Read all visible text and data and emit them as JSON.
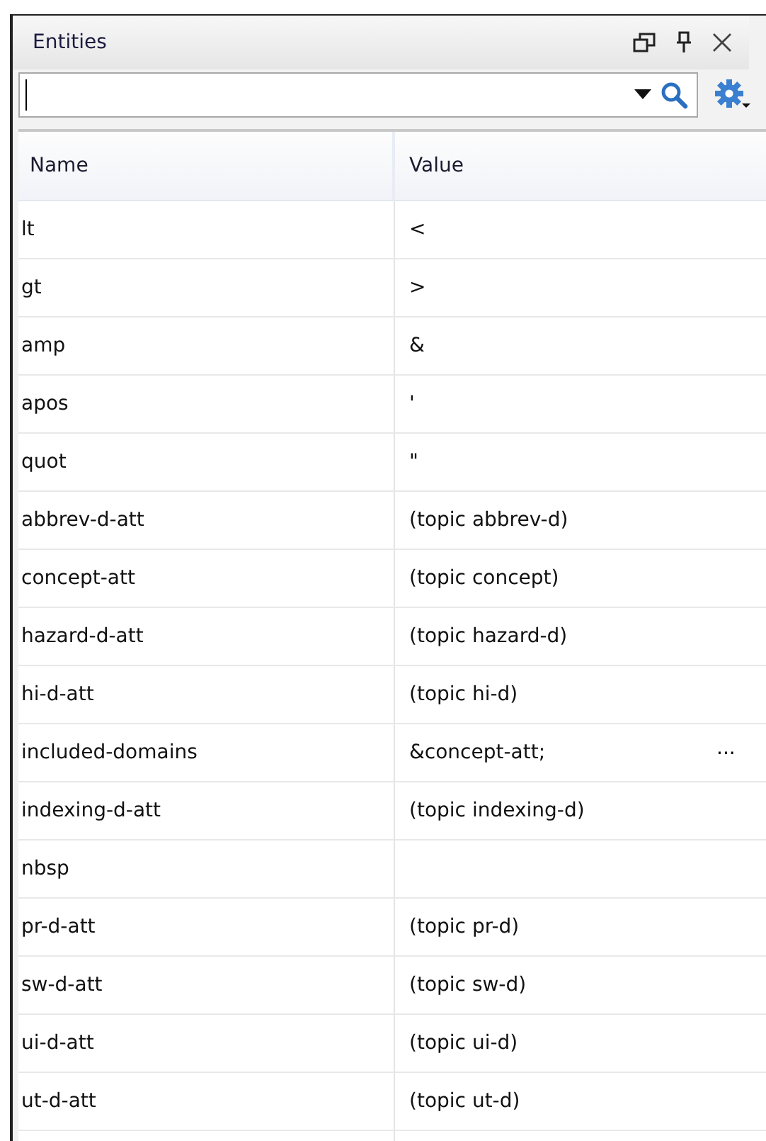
{
  "window": {
    "title": "Entities"
  },
  "table": {
    "columns": [
      "Name",
      "Value"
    ],
    "rows": [
      {
        "name": "lt",
        "value": "<"
      },
      {
        "name": "gt",
        "value": ">"
      },
      {
        "name": "amp",
        "value": "&"
      },
      {
        "name": "apos",
        "value": "'"
      },
      {
        "name": "quot",
        "value": "\""
      },
      {
        "name": "abbrev-d-att",
        "value": "(topic abbrev-d)"
      },
      {
        "name": "concept-att",
        "value": "(topic concept)"
      },
      {
        "name": "hazard-d-att",
        "value": "(topic hazard-d)"
      },
      {
        "name": "hi-d-att",
        "value": "(topic hi-d)"
      },
      {
        "name": "included-domains",
        "value": "&concept-att;",
        "more": "..."
      },
      {
        "name": "indexing-d-att",
        "value": "(topic indexing-d)"
      },
      {
        "name": "nbsp",
        "value": ""
      },
      {
        "name": "pr-d-att",
        "value": "(topic pr-d)"
      },
      {
        "name": "sw-d-att",
        "value": "(topic sw-d)"
      },
      {
        "name": "ui-d-att",
        "value": "(topic ui-d)"
      },
      {
        "name": "ut-d-att",
        "value": "(topic ut-d)"
      }
    ]
  }
}
